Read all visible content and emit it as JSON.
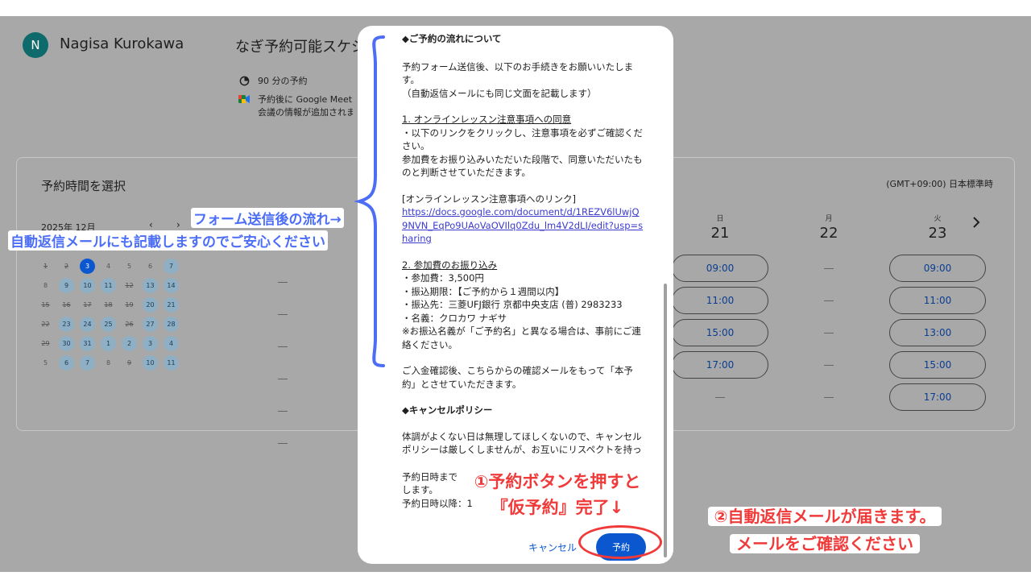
{
  "header": {
    "avatar_initial": "N",
    "host_name": "Nagisa Kurokawa",
    "schedule_title": "なぎ予約可能スケジュール",
    "duration": "90 分の予約",
    "meet_line1": "予約後に Google Meet のビデオ",
    "meet_line2": "会議の情報が追加されます"
  },
  "panel": {
    "title": "予約時間を選択",
    "timezone": "(GMT+09:00) 日本標準時",
    "month": "2025年 12月",
    "prev": "‹",
    "next": "›"
  },
  "mini_calendar": [
    {
      "d": "1",
      "s": "past"
    },
    {
      "d": "2",
      "s": "past"
    },
    {
      "d": "3",
      "s": "sel"
    },
    {
      "d": "4",
      "s": "dim"
    },
    {
      "d": "5",
      "s": "dim"
    },
    {
      "d": "6",
      "s": "dim"
    },
    {
      "d": "7",
      "s": "avail"
    },
    {
      "d": "8",
      "s": "dim"
    },
    {
      "d": "9",
      "s": "avail"
    },
    {
      "d": "10",
      "s": "avail"
    },
    {
      "d": "11",
      "s": "avail"
    },
    {
      "d": "12",
      "s": "past"
    },
    {
      "d": "13",
      "s": "avail"
    },
    {
      "d": "14",
      "s": "avail"
    },
    {
      "d": "15",
      "s": "past"
    },
    {
      "d": "16",
      "s": "past"
    },
    {
      "d": "17",
      "s": "past"
    },
    {
      "d": "18",
      "s": "past"
    },
    {
      "d": "19",
      "s": "past"
    },
    {
      "d": "20",
      "s": "avail"
    },
    {
      "d": "21",
      "s": "avail"
    },
    {
      "d": "22",
      "s": "past"
    },
    {
      "d": "23",
      "s": "avail"
    },
    {
      "d": "24",
      "s": "avail"
    },
    {
      "d": "25",
      "s": "avail"
    },
    {
      "d": "26",
      "s": "past"
    },
    {
      "d": "27",
      "s": "avail"
    },
    {
      "d": "28",
      "s": "avail"
    },
    {
      "d": "29",
      "s": "past"
    },
    {
      "d": "30",
      "s": "avail"
    },
    {
      "d": "31",
      "s": "avail"
    },
    {
      "d": "1",
      "s": "avail"
    },
    {
      "d": "2",
      "s": "avail"
    },
    {
      "d": "3",
      "s": "avail"
    },
    {
      "d": "4",
      "s": "avail"
    },
    {
      "d": "5",
      "s": "dim"
    },
    {
      "d": "6",
      "s": "avail"
    },
    {
      "d": "7",
      "s": "avail"
    },
    {
      "d": "8",
      "s": "dim"
    },
    {
      "d": "9",
      "s": "past"
    },
    {
      "d": "10",
      "s": "avail"
    },
    {
      "d": "11",
      "s": "avail"
    }
  ],
  "days": [
    {
      "dow": "日",
      "num": "21",
      "slots": [
        "09:00",
        "11:00",
        "15:00",
        "17:00"
      ]
    },
    {
      "dow": "月",
      "num": "22",
      "slots": []
    },
    {
      "dow": "火",
      "num": "23",
      "slots": [
        "09:00",
        "11:00",
        "13:00",
        "15:00",
        "17:00"
      ]
    }
  ],
  "modal": {
    "heading_flow": "◆ご予約の流れについて",
    "intro": "予約フォーム送信後、以下のお手続きをお願いいたします。\n（自動返信メールにも同じ文面を記載します）",
    "step1_title": "1. オンラインレッスン注意事項への同意",
    "step1_body": "・以下のリンクをクリックし、注意事項を必ずご確認ください。\n参加費をお振り込みいただいた段階で、同意いただいたものと判断させていただきます。",
    "link_label": "[オンラインレッスン注意事項へのリンク]",
    "link_url": "https://docs.google.com/document/d/1REZV6lUwjQ9NVN_EqPo9UAoVaOVIlq0Zdu_lm4V2dLI/edit?usp=sharing",
    "step2_title": "2. 参加費のお振り込み",
    "step2_body": "・参加費：3,500円\n・振込期限：【ご予約から１週間以内】\n・振込先：三菱UFJ銀行 京都中央支店 (普) 2983233\n・名義：クロカワ ナギサ\n※お振込名義が「ご予約名」と異なる場合は、事前にご連絡ください。",
    "confirm": "ご入金確認後、こちらからの確認メールをもって「本予約」とさせていただきます。",
    "heading_cancel": "◆キャンセルポリシー",
    "cancel_body": "体調がよくない日は無理してほしくないので、キャンセルポリシーは厳しくしませんが、お互いにリスペクトを持った姿勢で、配慮し合えると嬉しいです。",
    "cancel_rule": "予約日時まで\nします。\n予約日時以降：1",
    "cancel_label": "キャンセル",
    "book_label": "予約"
  },
  "annotations": {
    "flow_title": "フォーム送信後の流れ→",
    "flow_note": "自動返信メールにも記載しますのでご安心ください",
    "step_book_1": "①予約ボタンを押すと",
    "step_book_2": "『仮予約』完了↓",
    "step_mail_1": "②自動返信メールが届きます。",
    "step_mail_2": "メールをご確認ください"
  },
  "colors": {
    "accent": "#0b57d0",
    "annotation_blue": "#4c6ef5",
    "annotation_red": "#f03a3a"
  }
}
